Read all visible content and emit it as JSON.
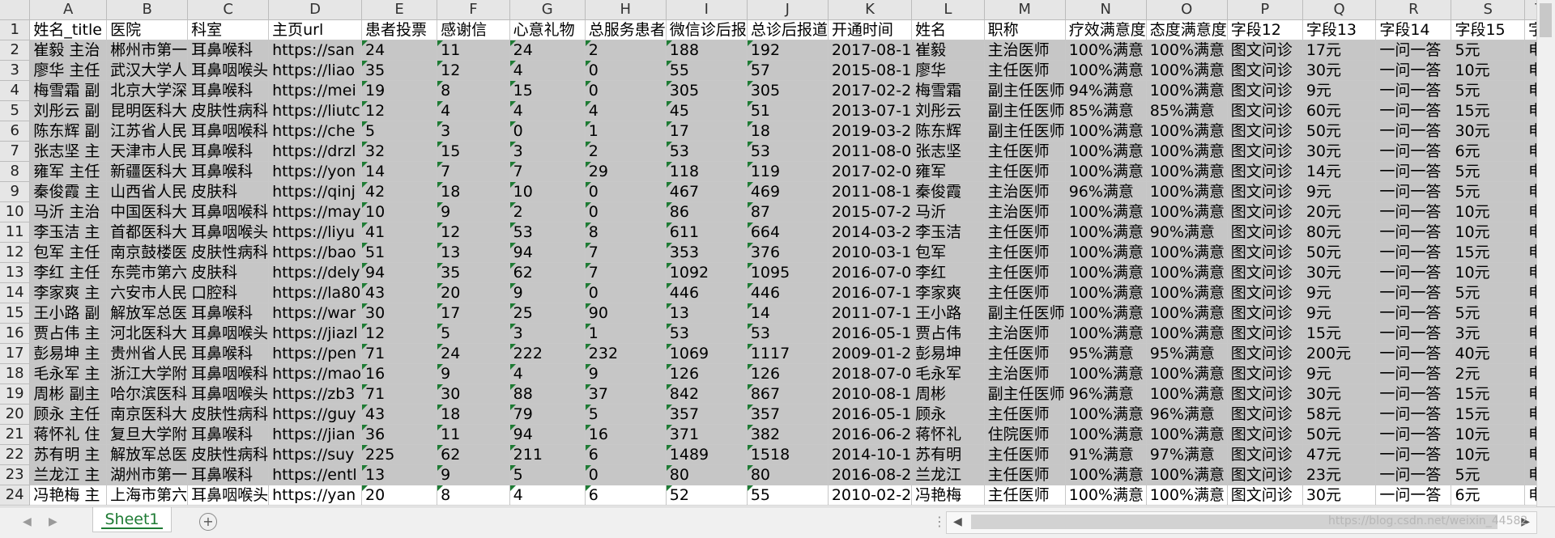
{
  "columns": [
    "A",
    "B",
    "C",
    "D",
    "E",
    "F",
    "G",
    "H",
    "I",
    "J",
    "K",
    "L",
    "M",
    "N",
    "O",
    "P",
    "Q",
    "R",
    "S",
    "T"
  ],
  "rows": [
    {
      "num": "1",
      "cells": [
        "姓名_title",
        "医院",
        "科室",
        "主页url",
        "患者投票",
        "感谢信",
        "心意礼物",
        "总服务患者",
        "微信诊后报",
        "总诊后报道",
        "开通时间",
        "姓名",
        "职称",
        "疗效满意度",
        "态度满意度",
        "字段12",
        "字段13",
        "字段14",
        "字段15",
        "字"
      ]
    },
    {
      "num": "2",
      "cells": [
        "崔毅 主治",
        "郴州市第一",
        "耳鼻喉科",
        "https://san",
        "24",
        "11",
        "24",
        "2",
        "188",
        "192",
        "2017-08-1",
        "崔毅",
        "主治医师",
        "100%满意",
        "100%满意",
        "图文问诊",
        "17元",
        "一问一答",
        "5元",
        "电"
      ]
    },
    {
      "num": "3",
      "cells": [
        "廖华 主任",
        "武汉大学人",
        "耳鼻咽喉头",
        "https://liao",
        "35",
        "12",
        "4",
        "0",
        "55",
        "57",
        "2015-08-1",
        "廖华",
        "主任医师",
        "100%满意",
        "100%满意",
        "图文问诊",
        "30元",
        "一问一答",
        "10元",
        "电"
      ]
    },
    {
      "num": "4",
      "cells": [
        "梅雪霜 副",
        "北京大学深",
        "耳鼻喉科",
        "https://mei",
        "19",
        "8",
        "15",
        "0",
        "305",
        "305",
        "2017-02-2",
        "梅雪霜",
        "副主任医师",
        "94%满意",
        "100%满意",
        "图文问诊",
        "9元",
        "一问一答",
        "5元",
        "电"
      ]
    },
    {
      "num": "5",
      "cells": [
        "刘彤云 副",
        "昆明医科大",
        "皮肤性病科",
        "https://liutc",
        "12",
        "4",
        "4",
        "4",
        "45",
        "51",
        "2013-07-1",
        "刘彤云",
        "副主任医师",
        "85%满意",
        "85%满意",
        "图文问诊",
        "60元",
        "一问一答",
        "15元",
        "电"
      ]
    },
    {
      "num": "6",
      "cells": [
        "陈东辉 副",
        "江苏省人民",
        "耳鼻咽喉科",
        "https://che",
        "5",
        "3",
        "0",
        "1",
        "17",
        "18",
        "2019-03-2",
        "陈东辉",
        "副主任医师",
        "100%满意",
        "100%满意",
        "图文问诊",
        "50元",
        "一问一答",
        "30元",
        "电"
      ]
    },
    {
      "num": "7",
      "cells": [
        "张志坚 主",
        "天津市人民",
        "耳鼻喉科",
        "https://drzl",
        "32",
        "15",
        "3",
        "2",
        "53",
        "53",
        "2011-08-0",
        "张志坚",
        "主任医师",
        "100%满意",
        "100%满意",
        "图文问诊",
        "30元",
        "一问一答",
        "6元",
        "电"
      ]
    },
    {
      "num": "8",
      "cells": [
        "雍军 主任",
        "新疆医科大",
        "耳鼻喉科",
        "https://yon",
        "14",
        "7",
        "7",
        "29",
        "118",
        "119",
        "2017-02-0",
        "雍军",
        "主任医师",
        "100%满意",
        "100%满意",
        "图文问诊",
        "14元",
        "一问一答",
        "5元",
        "电"
      ]
    },
    {
      "num": "9",
      "cells": [
        "秦俊霞 主",
        "山西省人民",
        "皮肤科",
        "https://qinj",
        "42",
        "18",
        "10",
        "0",
        "467",
        "469",
        "2011-08-1",
        "秦俊霞",
        "主治医师",
        "96%满意",
        "100%满意",
        "图文问诊",
        "9元",
        "一问一答",
        "5元",
        "电"
      ]
    },
    {
      "num": "10",
      "cells": [
        "马沂 主治",
        "中国医科大",
        "耳鼻咽喉科",
        "https://may",
        "10",
        "9",
        "2",
        "0",
        "86",
        "87",
        "2015-07-2",
        "马沂",
        "主治医师",
        "100%满意",
        "100%满意",
        "图文问诊",
        "20元",
        "一问一答",
        "10元",
        "电"
      ]
    },
    {
      "num": "11",
      "cells": [
        "李玉洁 主",
        "首都医科大",
        "耳鼻咽喉头",
        "https://liyu",
        "41",
        "12",
        "53",
        "8",
        "611",
        "664",
        "2014-03-2",
        "李玉洁",
        "主任医师",
        "100%满意",
        "90%满意",
        "图文问诊",
        "80元",
        "一问一答",
        "10元",
        "电"
      ]
    },
    {
      "num": "12",
      "cells": [
        "包军 主任",
        "南京鼓楼医",
        "皮肤性病科",
        "https://bao",
        "51",
        "13",
        "94",
        "7",
        "353",
        "376",
        "2010-03-1",
        "包军",
        "主任医师",
        "100%满意",
        "100%满意",
        "图文问诊",
        "50元",
        "一问一答",
        "15元",
        "电"
      ]
    },
    {
      "num": "13",
      "cells": [
        "李红 主任",
        "东莞市第六",
        "皮肤科",
        "https://dely",
        "94",
        "35",
        "62",
        "7",
        "1092",
        "1095",
        "2016-07-0",
        "李红",
        "主任医师",
        "100%满意",
        "100%满意",
        "图文问诊",
        "30元",
        "一问一答",
        "10元",
        "电"
      ]
    },
    {
      "num": "14",
      "cells": [
        "李家爽 主",
        "六安市人民",
        "口腔科",
        "https://la80",
        "43",
        "20",
        "9",
        "0",
        "446",
        "446",
        "2016-07-1",
        "李家爽",
        "主任医师",
        "100%满意",
        "100%满意",
        "图文问诊",
        "9元",
        "一问一答",
        "5元",
        "电"
      ]
    },
    {
      "num": "15",
      "cells": [
        "王小路 副",
        "解放军总医",
        "耳鼻喉科",
        "https://war",
        "30",
        "17",
        "25",
        "90",
        "13",
        "14",
        "2011-07-1",
        "王小路",
        "副主任医师",
        "100%满意",
        "100%满意",
        "图文问诊",
        "9元",
        "一问一答",
        "5元",
        "电"
      ]
    },
    {
      "num": "16",
      "cells": [
        "贾占伟 主",
        "河北医科大",
        "耳鼻咽喉头",
        "https://jiazl",
        "12",
        "5",
        "3",
        "1",
        "53",
        "53",
        "2016-05-1",
        "贾占伟",
        "主治医师",
        "100%满意",
        "100%满意",
        "图文问诊",
        "15元",
        "一问一答",
        "3元",
        "电"
      ]
    },
    {
      "num": "17",
      "cells": [
        "彭易坤 主",
        "贵州省人民",
        "耳鼻喉科",
        "https://pen",
        "71",
        "24",
        "222",
        "232",
        "1069",
        "1117",
        "2009-01-2",
        "彭易坤",
        "主任医师",
        "95%满意",
        "95%满意",
        "图文问诊",
        "200元",
        "一问一答",
        "40元",
        "电"
      ]
    },
    {
      "num": "18",
      "cells": [
        "毛永军 主",
        "浙江大学附",
        "耳鼻咽喉科",
        "https://mao",
        "16",
        "9",
        "4",
        "9",
        "126",
        "126",
        "2018-07-0",
        "毛永军",
        "主治医师",
        "100%满意",
        "100%满意",
        "图文问诊",
        "9元",
        "一问一答",
        "2元",
        "电"
      ]
    },
    {
      "num": "19",
      "cells": [
        "周彬 副主",
        "哈尔滨医科",
        "耳鼻咽喉头",
        "https://zb3",
        "71",
        "30",
        "88",
        "37",
        "842",
        "867",
        "2010-08-1",
        "周彬",
        "副主任医师",
        "96%满意",
        "100%满意",
        "图文问诊",
        "30元",
        "一问一答",
        "15元",
        "电"
      ]
    },
    {
      "num": "20",
      "cells": [
        "顾永 主任",
        "南京医科大",
        "皮肤性病科",
        "https://guy",
        "43",
        "18",
        "79",
        "5",
        "357",
        "357",
        "2016-05-1",
        "顾永",
        "主任医师",
        "100%满意",
        "96%满意",
        "图文问诊",
        "58元",
        "一问一答",
        "15元",
        "电"
      ]
    },
    {
      "num": "21",
      "cells": [
        "蒋怀礼 住",
        "复旦大学附",
        "耳鼻喉科",
        "https://jian",
        "36",
        "11",
        "94",
        "16",
        "371",
        "382",
        "2016-06-2",
        "蒋怀礼",
        "住院医师",
        "100%满意",
        "100%满意",
        "图文问诊",
        "50元",
        "一问一答",
        "10元",
        "电"
      ]
    },
    {
      "num": "22",
      "cells": [
        "苏有明 主",
        "解放军总医",
        "皮肤性病科",
        "https://suy",
        "225",
        "62",
        "211",
        "6",
        "1489",
        "1518",
        "2014-10-1",
        "苏有明",
        "主任医师",
        "91%满意",
        "97%满意",
        "图文问诊",
        "47元",
        "一问一答",
        "10元",
        "电"
      ]
    },
    {
      "num": "23",
      "cells": [
        "兰龙江 主",
        "湖州市第一",
        "耳鼻喉科",
        "https://entl",
        "13",
        "9",
        "5",
        "0",
        "80",
        "80",
        "2016-08-2",
        "兰龙江",
        "主任医师",
        "100%满意",
        "100%满意",
        "图文问诊",
        "23元",
        "一问一答",
        "5元",
        "电"
      ]
    },
    {
      "num": "24",
      "cells": [
        "冯艳梅 主",
        "上海市第六",
        "耳鼻咽喉头",
        "https://yan",
        "20",
        "8",
        "4",
        "6",
        "52",
        "55",
        "2010-02-2",
        "冯艳梅",
        "主任医师",
        "100%满意",
        "100%满意",
        "图文问诊",
        "30元",
        "一问一答",
        "6元",
        "电"
      ]
    }
  ],
  "sheet_tab": "Sheet1",
  "add_sheet_glyph": "+",
  "watermark": "https://blog.csdn.net/weixin_44582"
}
